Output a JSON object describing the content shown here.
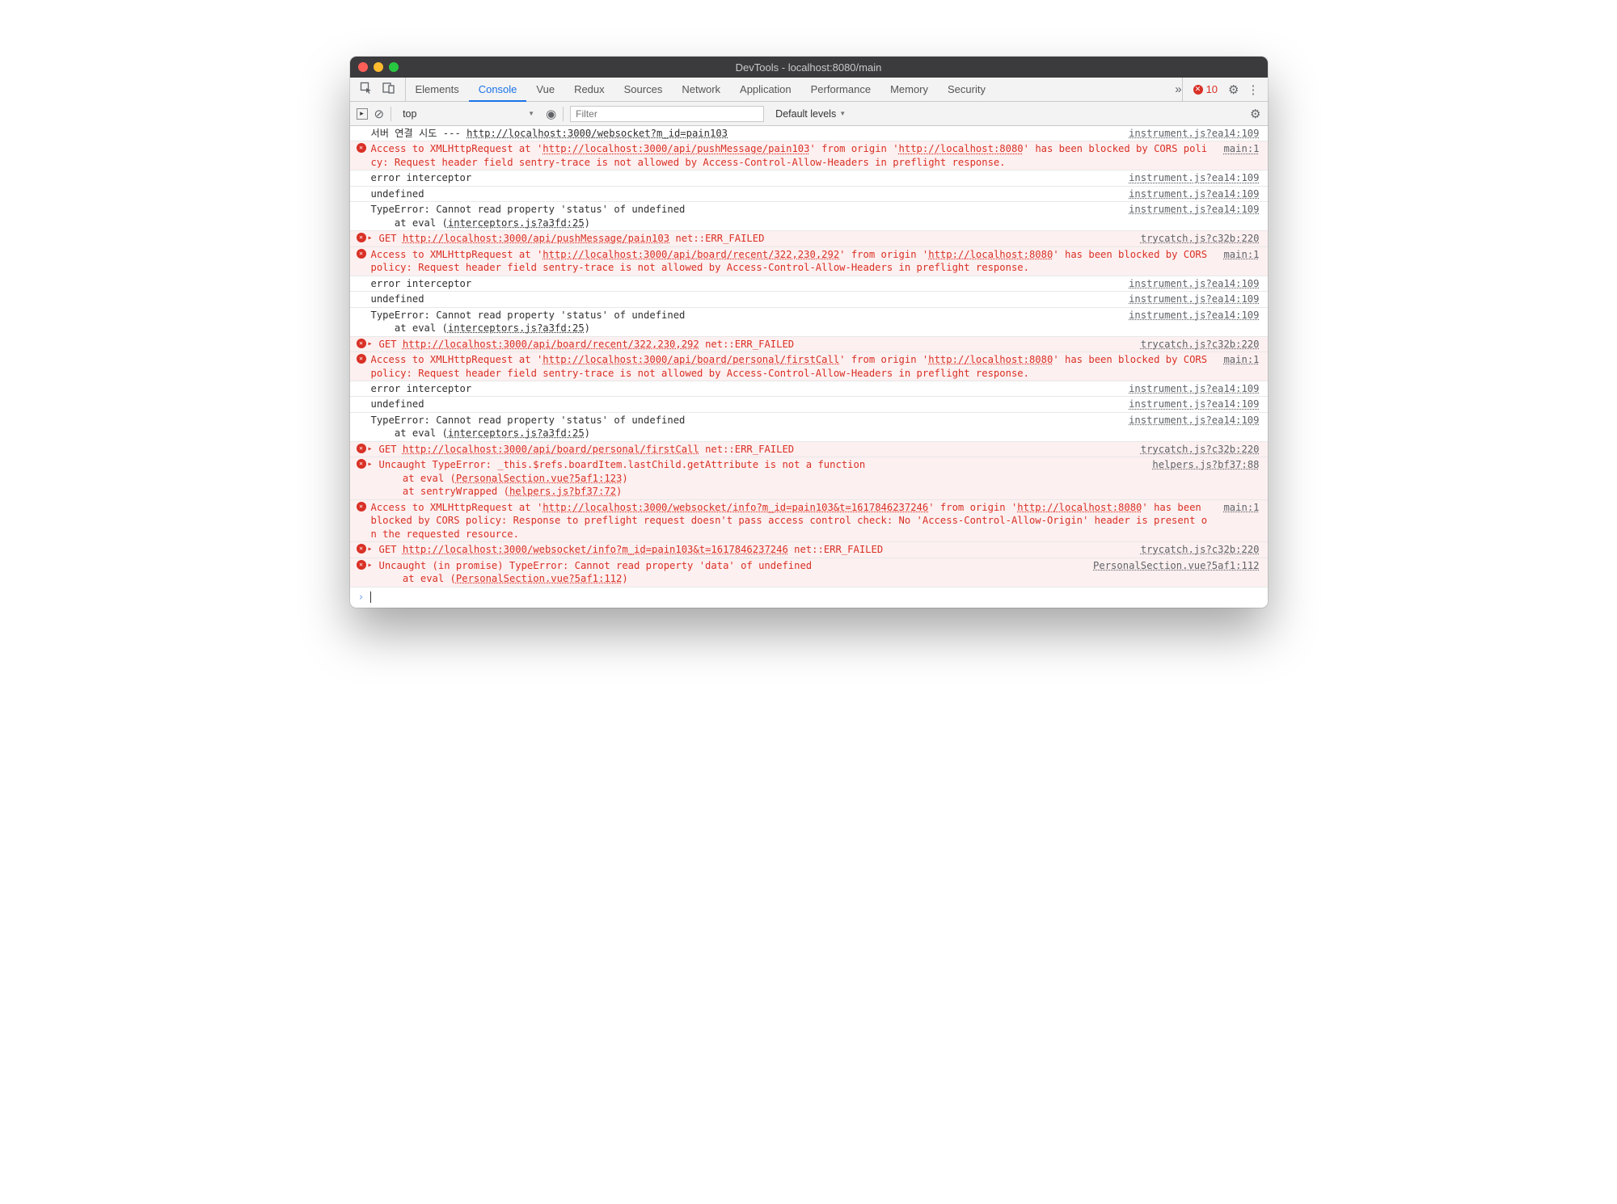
{
  "window_title": "DevTools - localhost:8080/main",
  "tabs": [
    "Elements",
    "Console",
    "Vue",
    "Redux",
    "Sources",
    "Network",
    "Application",
    "Performance",
    "Memory",
    "Security"
  ],
  "active_tab": 1,
  "error_count": "10",
  "toolbar": {
    "context": "top",
    "filter_placeholder": "Filter",
    "levels": "Default levels"
  },
  "messages": [
    {
      "type": "plain",
      "src": "instrument.js?ea14:109",
      "segs": [
        {
          "t": "서버 연결 시도 --- "
        },
        {
          "t": "http://localhost:3000/websocket?m_id=pain103",
          "u": true
        }
      ]
    },
    {
      "type": "err",
      "icon": true,
      "src": "main:1",
      "segs": [
        {
          "t": "Access to XMLHttpRequest at '"
        },
        {
          "t": "http://localhost:3000/api/pushMessage/pain103",
          "u": true
        },
        {
          "t": "' from origin '"
        },
        {
          "t": "http://localhost:8080",
          "u": true
        },
        {
          "t": "' has been blocked by CORS policy: Request header field sentry-trace is not allowed by Access-Control-Allow-Headers in preflight response."
        }
      ]
    },
    {
      "type": "plain",
      "src": "instrument.js?ea14:109",
      "segs": [
        {
          "t": "error interceptor"
        }
      ]
    },
    {
      "type": "plain",
      "src": "instrument.js?ea14:109",
      "segs": [
        {
          "t": "undefined"
        }
      ]
    },
    {
      "type": "plain",
      "src": "instrument.js?ea14:109",
      "segs": [
        {
          "t": "TypeError: Cannot read property 'status' of undefined\n    at eval ("
        },
        {
          "t": "interceptors.js?a3fd:25",
          "u": true
        },
        {
          "t": ")"
        }
      ]
    },
    {
      "type": "err",
      "icon": true,
      "expand": true,
      "src": "trycatch.js?c32b:220",
      "segs": [
        {
          "t": "GET "
        },
        {
          "t": "http://localhost:3000/api/pushMessage/pain103",
          "u": true
        },
        {
          "t": " net::ERR_FAILED"
        }
      ]
    },
    {
      "type": "err",
      "icon": true,
      "src": "main:1",
      "segs": [
        {
          "t": "Access to XMLHttpRequest at '"
        },
        {
          "t": "http://localhost:3000/api/board/recent/322,230,292",
          "u": true
        },
        {
          "t": "' from origin '"
        },
        {
          "t": "http://localhost:8080",
          "u": true
        },
        {
          "t": "' has been blocked by CORS policy: Request header field sentry-trace is not allowed by Access-Control-Allow-Headers in preflight response."
        }
      ]
    },
    {
      "type": "plain",
      "src": "instrument.js?ea14:109",
      "segs": [
        {
          "t": "error interceptor"
        }
      ]
    },
    {
      "type": "plain",
      "src": "instrument.js?ea14:109",
      "segs": [
        {
          "t": "undefined"
        }
      ]
    },
    {
      "type": "plain",
      "src": "instrument.js?ea14:109",
      "segs": [
        {
          "t": "TypeError: Cannot read property 'status' of undefined\n    at eval ("
        },
        {
          "t": "interceptors.js?a3fd:25",
          "u": true
        },
        {
          "t": ")"
        }
      ]
    },
    {
      "type": "err",
      "icon": true,
      "expand": true,
      "src": "trycatch.js?c32b:220",
      "segs": [
        {
          "t": "GET "
        },
        {
          "t": "http://localhost:3000/api/board/recent/322,230,292",
          "u": true
        },
        {
          "t": " net::ERR_FAILED"
        }
      ]
    },
    {
      "type": "err",
      "icon": true,
      "src": "main:1",
      "segs": [
        {
          "t": "Access to XMLHttpRequest at '"
        },
        {
          "t": "http://localhost:3000/api/board/personal/firstCall",
          "u": true
        },
        {
          "t": "' from origin '"
        },
        {
          "t": "http://localhost:8080",
          "u": true
        },
        {
          "t": "' has been blocked by CORS policy: Request header field sentry-trace is not allowed by Access-Control-Allow-Headers in preflight response."
        }
      ]
    },
    {
      "type": "plain",
      "src": "instrument.js?ea14:109",
      "segs": [
        {
          "t": "error interceptor"
        }
      ]
    },
    {
      "type": "plain",
      "src": "instrument.js?ea14:109",
      "segs": [
        {
          "t": "undefined"
        }
      ]
    },
    {
      "type": "plain",
      "src": "instrument.js?ea14:109",
      "segs": [
        {
          "t": "TypeError: Cannot read property 'status' of undefined\n    at eval ("
        },
        {
          "t": "interceptors.js?a3fd:25",
          "u": true
        },
        {
          "t": ")"
        }
      ]
    },
    {
      "type": "err",
      "icon": true,
      "expand": true,
      "src": "trycatch.js?c32b:220",
      "segs": [
        {
          "t": "GET "
        },
        {
          "t": "http://localhost:3000/api/board/personal/firstCall",
          "u": true
        },
        {
          "t": " net::ERR_FAILED"
        }
      ]
    },
    {
      "type": "err",
      "icon": true,
      "expand": true,
      "src": "helpers.js?bf37:88",
      "segs": [
        {
          "t": "Uncaught TypeError: _this.$refs.boardItem.lastChild.getAttribute is not a function\n    at eval ("
        },
        {
          "t": "PersonalSection.vue?5af1:123",
          "u": true
        },
        {
          "t": ")\n    at sentryWrapped ("
        },
        {
          "t": "helpers.js?bf37:72",
          "u": true
        },
        {
          "t": ")"
        }
      ]
    },
    {
      "type": "err",
      "icon": true,
      "src": "main:1",
      "segs": [
        {
          "t": "Access to XMLHttpRequest at '"
        },
        {
          "t": "http://localhost:3000/websocket/info?m_id=pain103&t=1617846237246",
          "u": true
        },
        {
          "t": "' from origin '"
        },
        {
          "t": "http://localhost:8080",
          "u": true
        },
        {
          "t": "' has been blocked by CORS policy: Response to preflight request doesn't pass access control check: No 'Access-Control-Allow-Origin' header is present on the requested resource."
        }
      ]
    },
    {
      "type": "err",
      "icon": true,
      "expand": true,
      "src": "trycatch.js?c32b:220",
      "segs": [
        {
          "t": "GET "
        },
        {
          "t": "http://localhost:3000/websocket/info?m_id=pain103&t=1617846237246",
          "u": true
        },
        {
          "t": " net::ERR_FAILED"
        }
      ]
    },
    {
      "type": "err",
      "icon": true,
      "expand": true,
      "src": "PersonalSection.vue?5af1:112",
      "segs": [
        {
          "t": "Uncaught (in promise) TypeError: Cannot read property 'data' of undefined\n    at eval ("
        },
        {
          "t": "PersonalSection.vue?5af1:112",
          "u": true
        },
        {
          "t": ")"
        }
      ]
    }
  ]
}
